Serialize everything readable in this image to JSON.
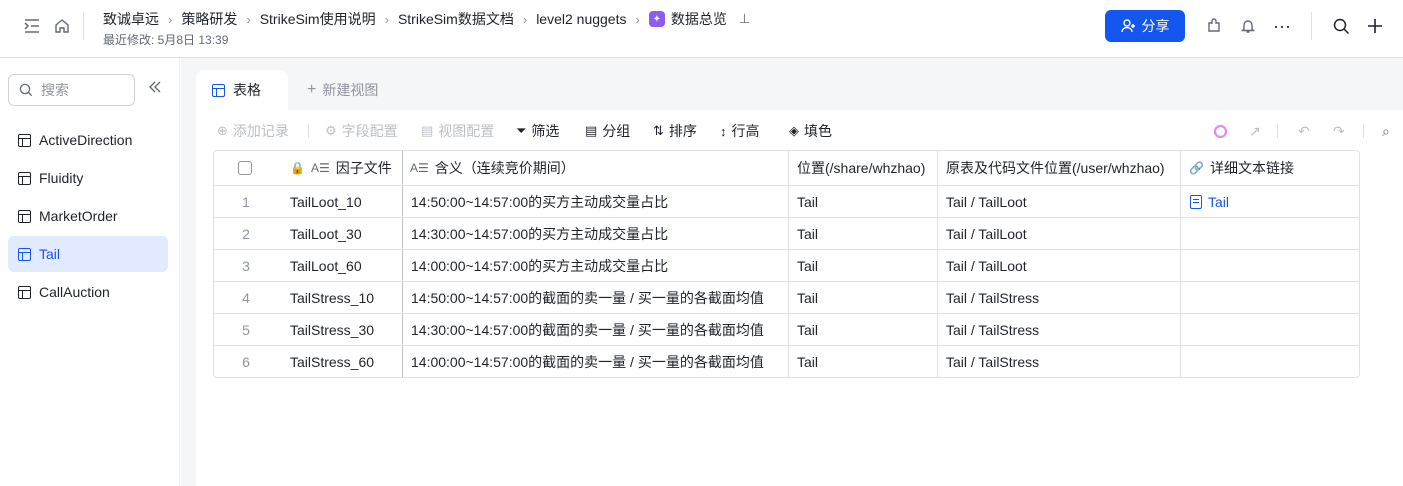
{
  "breadcrumbs": [
    "致诚卓远",
    "策略研发",
    "StrikeSim使用说明",
    "StrikeSim数据文档",
    "level2 nuggets"
  ],
  "doc_title": "数据总览",
  "modified": "最近修改: 5月8日 13:39",
  "share_label": "分享",
  "sidebar": {
    "search_placeholder": "搜索",
    "items": [
      {
        "label": "ActiveDirection"
      },
      {
        "label": "Fluidity"
      },
      {
        "label": "MarketOrder"
      },
      {
        "label": "Tail",
        "active": true
      },
      {
        "label": "CallAuction"
      }
    ]
  },
  "tabs": {
    "active": "表格",
    "new_view": "新建视图"
  },
  "toolbar": {
    "add_record": "添加记录",
    "field_config": "字段配置",
    "view_config": "视图配置",
    "filter": "筛选",
    "group": "分组",
    "sort": "排序",
    "row_height": "行高",
    "fill_color": "填色"
  },
  "table": {
    "columns": [
      "因子文件",
      "含义（连续竞价期间）",
      "位置(/share/whzhao)",
      "原表及代码文件位置(/user/whzhao)",
      "详细文本链接"
    ],
    "rows": [
      {
        "n": "1",
        "file": "TailLoot_10",
        "meaning": "14:50:00~14:57:00的买方主动成交量占比",
        "loc": "Tail",
        "src": "Tail / TailLoot",
        "link": "Tail"
      },
      {
        "n": "2",
        "file": "TailLoot_30",
        "meaning": "14:30:00~14:57:00的买方主动成交量占比",
        "loc": "Tail",
        "src": "Tail / TailLoot",
        "link": ""
      },
      {
        "n": "3",
        "file": "TailLoot_60",
        "meaning": "14:00:00~14:57:00的买方主动成交量占比",
        "loc": "Tail",
        "src": "Tail / TailLoot",
        "link": ""
      },
      {
        "n": "4",
        "file": "TailStress_10",
        "meaning": "14:50:00~14:57:00的截面的卖一量 / 买一量的各截面均值",
        "loc": "Tail",
        "src": "Tail / TailStress",
        "link": ""
      },
      {
        "n": "5",
        "file": "TailStress_30",
        "meaning": "14:30:00~14:57:00的截面的卖一量 / 买一量的各截面均值",
        "loc": "Tail",
        "src": "Tail / TailStress",
        "link": ""
      },
      {
        "n": "6",
        "file": "TailStress_60",
        "meaning": "14:00:00~14:57:00的截面的卖一量 / 买一量的各截面均值",
        "loc": "Tail",
        "src": "Tail / TailStress",
        "link": ""
      }
    ]
  },
  "colors": {
    "accent": "#1456f0",
    "active_bg": "#e1eaff",
    "doc_badge": "#8c5cf0"
  }
}
